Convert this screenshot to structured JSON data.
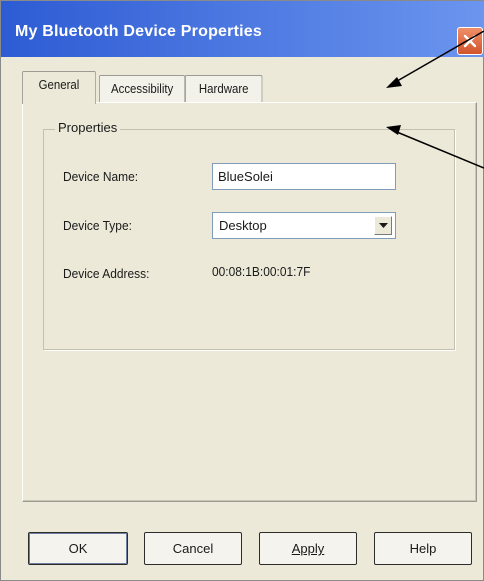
{
  "window": {
    "title": "My Bluetooth Device Properties",
    "close_icon": "close-icon"
  },
  "tabs": [
    {
      "label": "General",
      "active": true
    },
    {
      "label": "Accessibility",
      "active": false
    },
    {
      "label": "Hardware",
      "active": false
    }
  ],
  "properties": {
    "group_label": "Properties",
    "device_name": {
      "label": "Device Name:",
      "value": "BlueSolei"
    },
    "device_type": {
      "label": "Device Type:",
      "value": "Desktop"
    },
    "device_address": {
      "label": "Device Address:",
      "value": "00:08:1B:00:01:7F"
    }
  },
  "buttons": {
    "ok": "OK",
    "cancel": "Cancel",
    "apply": "Apply",
    "help": "Help"
  },
  "colors": {
    "titlebar": "#2d5bd3",
    "dialog_bg": "#ece9d8",
    "close_button": "#d1542c"
  }
}
